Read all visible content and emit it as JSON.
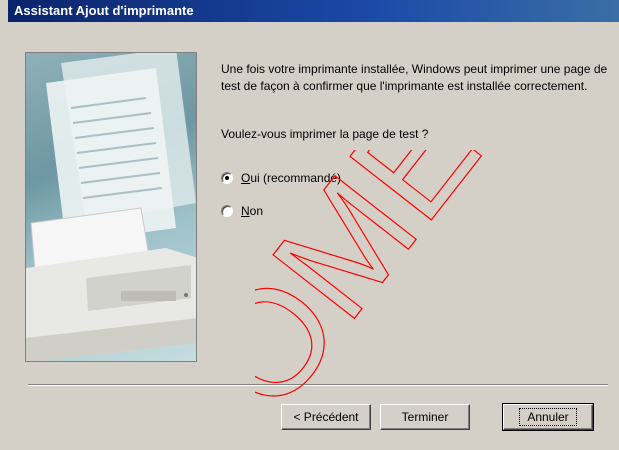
{
  "window": {
    "title": "Assistant Ajout d'imprimante"
  },
  "description": "Une fois votre imprimante installée, Windows peut imprimer une page de test de façon à confirmer que l'imprimante est installée correctement.",
  "question": "Voulez-vous imprimer la page de test ?",
  "options": [
    {
      "label": "Oui (recommandé)",
      "selected": true
    },
    {
      "label": "Non",
      "selected": false
    }
  ],
  "buttons": {
    "back": "< Précédent",
    "finish": "Terminer",
    "cancel": "Annuler"
  },
  "watermark": {
    "text": "OMER",
    "color": "#ff0000"
  },
  "colors": {
    "titlebar": "#0a246a",
    "face": "#d4d0c8"
  }
}
